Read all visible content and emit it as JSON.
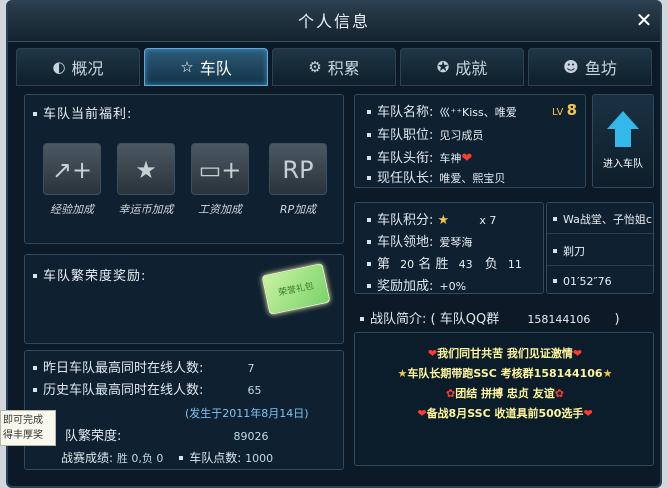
{
  "window": {
    "title": "个人信息",
    "close_label": "✕"
  },
  "tabs": [
    {
      "label": "概况",
      "icon": "overview-icon",
      "active": false
    },
    {
      "label": "车队",
      "icon": "star-icon",
      "active": true
    },
    {
      "label": "积累",
      "icon": "gear-icon",
      "active": false
    },
    {
      "label": "成就",
      "icon": "medal-icon",
      "active": false
    },
    {
      "label": "鱼坊",
      "icon": "pig-icon",
      "active": false
    }
  ],
  "benefits": {
    "title": "车队当前福利:",
    "items": [
      {
        "label": "经验加成",
        "icon": "exp-boost-icon",
        "glyph": "↗+"
      },
      {
        "label": "幸运币加成",
        "icon": "lucky-coin-icon",
        "glyph": "★"
      },
      {
        "label": "工资加成",
        "icon": "salary-card-icon",
        "glyph": "▭+"
      },
      {
        "label": "RP加成",
        "icon": "rp-boost-icon",
        "glyph": "RP"
      }
    ]
  },
  "prestige": {
    "title": "车队繁荣度奖励:",
    "gift_label": "荣誉礼包"
  },
  "stats": {
    "yesterday_label": "昨日车队最高同时在线人数:",
    "yesterday_value": "7",
    "history_label": "历史车队最高同时在线人数:",
    "history_value": "65",
    "history_date": "(发生于2011年8月14日)",
    "prosperity_label": "队繁荣度:",
    "prosperity_value": "89026",
    "race_label": "战赛成绩:",
    "race_value": "胜 0,负 0",
    "points_label": "车队点数:",
    "points_value": "1000"
  },
  "team": {
    "name_label": "车队名称:",
    "name_value": "巛⁺⁺Kiss、唯爱",
    "lv_label": "LV",
    "lv_value": "8",
    "position_label": "车队职位:",
    "position_value": "见习成员",
    "title_label": "车队头衔:",
    "title_value": "车神",
    "leader_label": "现任队长:",
    "leader_value": "唯爱、熙宝贝",
    "join_label": "进入车队"
  },
  "team_stats": {
    "score_label": "车队积分:",
    "score_value": "x 7",
    "territory_label": "车队领地:",
    "territory_value": "爱琴海",
    "rank_label": "第",
    "rank_value": "20",
    "rank_unit": "名",
    "win_label": "胜",
    "win_value": "43",
    "loss_label": "负",
    "loss_value": "11",
    "bonus_label": "奖励加成:",
    "bonus_value": "+0%"
  },
  "side": {
    "line1": "Wa战堂、子怡姐c",
    "line2": "剃刀",
    "line3": "01′52″76"
  },
  "intro": {
    "label": "战队简介:",
    "qq_label": "( 车队QQ群",
    "qq_value": "158144106",
    "qq_close": ")",
    "lines": [
      "我们同甘共苦  我们见证激情",
      "车队长期带跑SSC  考核群158144106",
      "团结 拼搏 忠贞 友谊",
      "备战8月SSC  收道具前500选手"
    ]
  },
  "tooltip": {
    "line1": "即可完成",
    "line2": "得丰厚奖"
  },
  "colors": {
    "accent": "#33b8ea",
    "gold": "#f3c84e",
    "panel": "#0f2030"
  }
}
